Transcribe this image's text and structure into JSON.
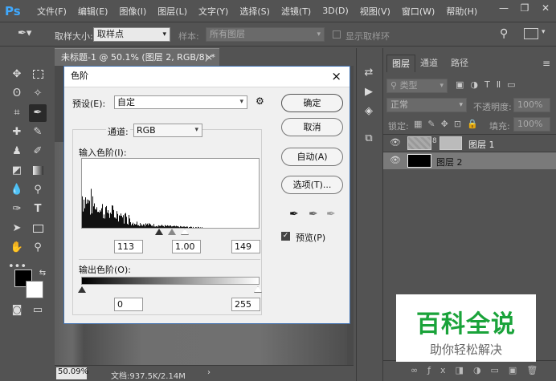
{
  "app": {
    "logo": "Ps"
  },
  "menubar": {
    "items": [
      "文件(F)",
      "编辑(E)",
      "图像(I)",
      "图层(L)",
      "文字(Y)",
      "选择(S)",
      "滤镜(T)",
      "3D(D)",
      "视图(V)",
      "窗口(W)",
      "帮助(H)"
    ]
  },
  "options": {
    "sample_size_label": "取样大小:",
    "sample_size_value": "取样点",
    "sample_label": "样本:",
    "sample_value": "所有图层",
    "show_ring_label": "显示取样环"
  },
  "document": {
    "tab_title": "未标题-1 @ 50.1% (图层 2, RGB/8) *",
    "tab_close": "×",
    "zoom": "50.09%",
    "status": "文档:937.5K/2.14M",
    "status_arrow": "›"
  },
  "layers_panel": {
    "tabs": [
      "图层",
      "通道",
      "路径"
    ],
    "filter_kind": "类型",
    "blend_mode": "正常",
    "opacity_label": "不透明度:",
    "opacity_value": "100%",
    "lock_label": "锁定:",
    "fill_label": "填充:",
    "fill_value": "100%",
    "layers": [
      {
        "name": "图层 1"
      },
      {
        "name": "图层 2"
      }
    ]
  },
  "dialog": {
    "title": "色阶",
    "close": "×",
    "preset_label": "预设(E):",
    "preset_value": "自定",
    "channel_label": "通道:",
    "channel_value": "RGB",
    "input_label": "输入色阶(I):",
    "input_black": "113",
    "input_gamma": "1.00",
    "input_white": "149",
    "output_label": "输出色阶(O):",
    "output_black": "0",
    "output_white": "255",
    "buttons": {
      "ok": "确定",
      "cancel": "取消",
      "auto": "自动(A)",
      "options": "选项(T)..."
    },
    "preview_label": "预览(P)",
    "preview_checked": true
  },
  "watermark": {
    "title": "百科全说",
    "subtitle": "助你轻松解决",
    "title_color": "#1aa33a"
  }
}
